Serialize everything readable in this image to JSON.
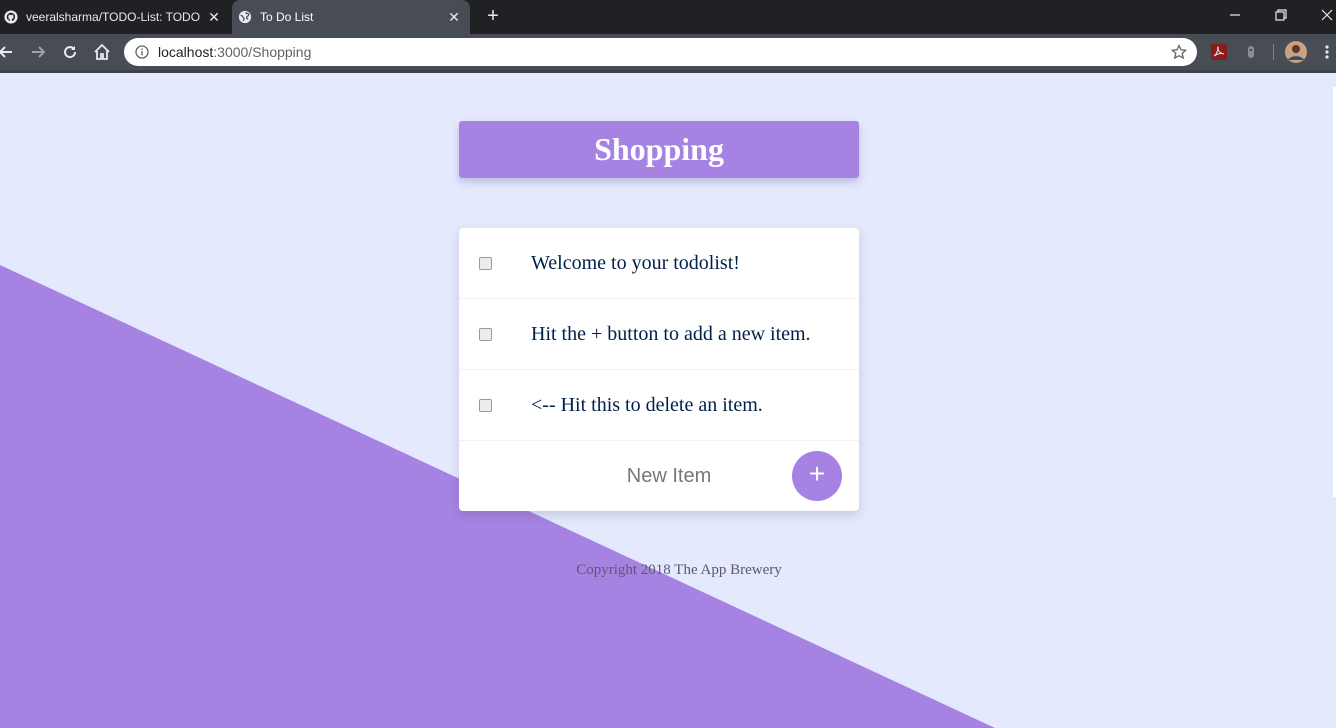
{
  "browser": {
    "tabs": [
      {
        "title": "veeralsharma/TODO-List: TODO l",
        "favicon": "github-icon",
        "active": false
      },
      {
        "title": "To Do List",
        "favicon": "globe-icon",
        "active": true
      }
    ],
    "address": {
      "host": "localhost",
      "path": ":3000/Shopping"
    },
    "colors": {
      "tabbar": "#202124",
      "toolbar": "#474c55"
    }
  },
  "page": {
    "heading": "Shopping",
    "items": [
      {
        "text": "Welcome to your todolist!",
        "checked": false
      },
      {
        "text": "Hit the + button to add a new item.",
        "checked": false
      },
      {
        "text": "<-- Hit this to delete an item.",
        "checked": false
      }
    ],
    "new_item_placeholder": "New Item",
    "add_button_label": "+",
    "footer": "Copyright 2018 The App Brewery",
    "colors": {
      "background": "#E4E9FD",
      "accent": "#A683E3",
      "item_text": "#00204A"
    }
  }
}
